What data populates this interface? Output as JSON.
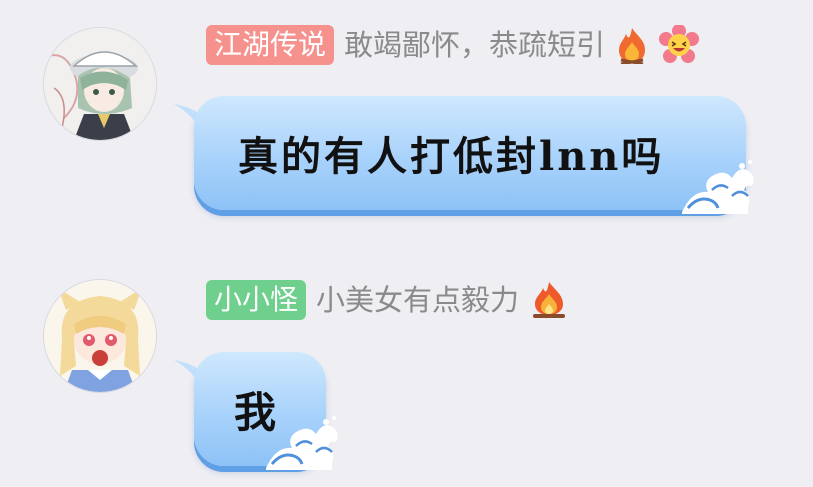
{
  "messages": [
    {
      "sender_tag": "江湖传说",
      "sender_tag_color": "#f6928e",
      "sender_title": "敢竭鄙怀，恭疏短引",
      "badges": [
        "fire-icon",
        "laughing-flower-icon"
      ],
      "text": "真的有人打低封lnn吗"
    },
    {
      "sender_tag": "小小怪",
      "sender_tag_color": "#6fcf8c",
      "sender_title": "小美女有点毅力",
      "badges": [
        "campfire-icon"
      ],
      "text": "我"
    }
  ],
  "colors": {
    "background": "#eeeef3",
    "bubble_top": "#cfe8fd",
    "bubble_bottom": "#8ec2f6",
    "title_text": "#8a8a8a"
  }
}
